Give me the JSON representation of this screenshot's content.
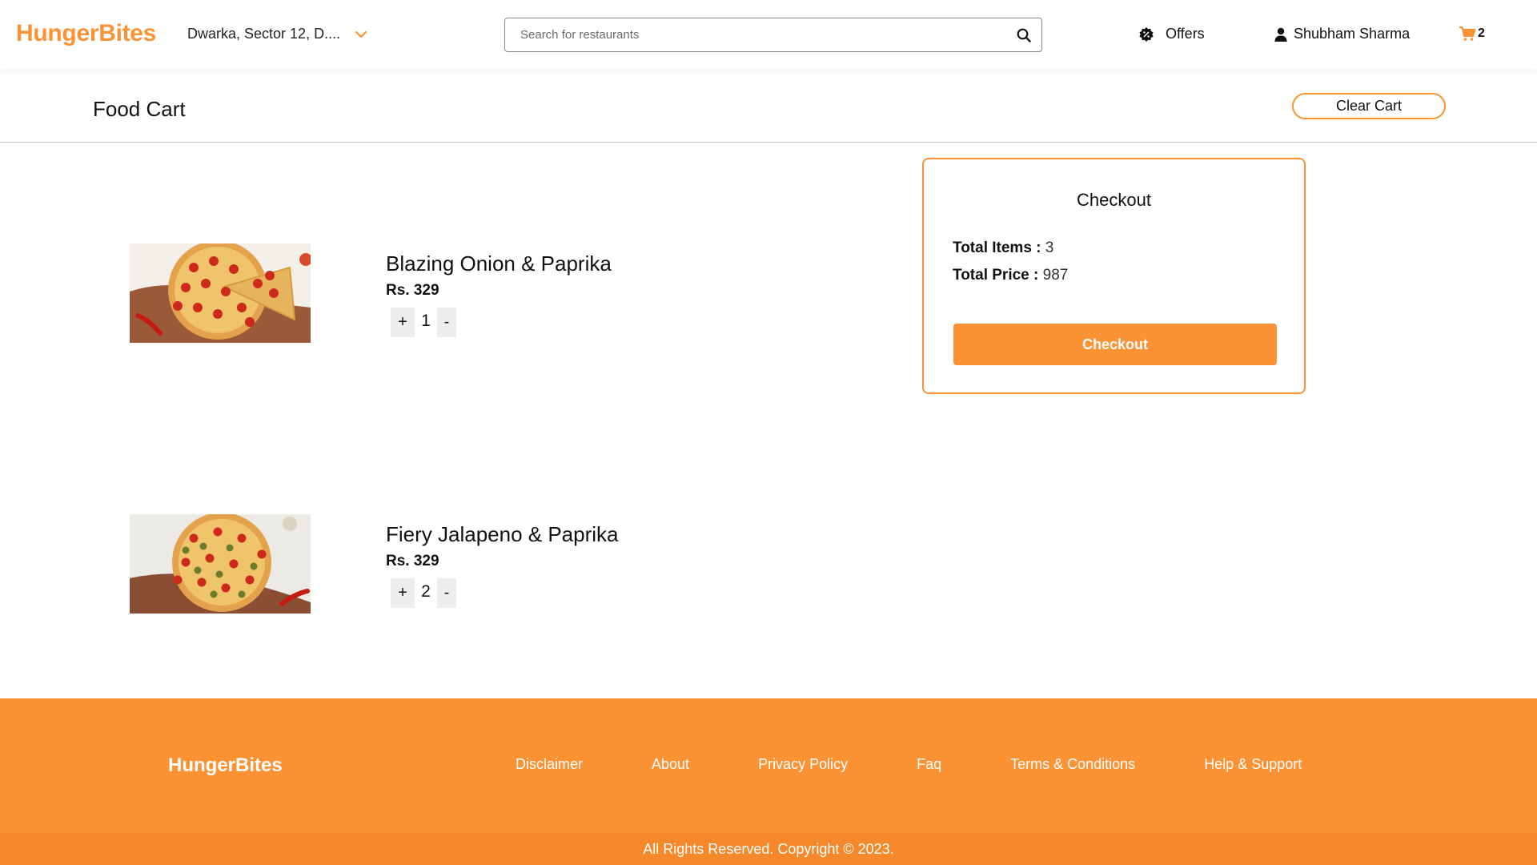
{
  "header": {
    "logo": "HungerBites",
    "location": "Dwarka, Sector 12, D....",
    "search_placeholder": "Search for restaurants",
    "offers_label": "Offers",
    "user_name": "Shubham Sharma",
    "cart_count": "2"
  },
  "cart": {
    "title": "Food Cart",
    "clear_label": "Clear Cart",
    "items": [
      {
        "name": "Blazing Onion & Paprika",
        "price": "Rs. 329",
        "quantity": "1",
        "plus": "+",
        "minus": "-"
      },
      {
        "name": "Fiery Jalapeno & Paprika",
        "price": "Rs. 329",
        "quantity": "2",
        "plus": "+",
        "minus": "-"
      }
    ]
  },
  "checkout": {
    "title": "Checkout",
    "total_items_label": "Total Items :",
    "total_items_value": "3",
    "total_price_label": "Total Price :",
    "total_price_value": "987",
    "button_label": "Checkout"
  },
  "footer": {
    "logo": "HungerBites",
    "links": [
      "Disclaimer",
      "About",
      "Privacy Policy",
      "Faq",
      "Terms & Conditions",
      "Help & Support"
    ],
    "copyright": "All Rights Reserved. Copyright © 2023."
  },
  "colors": {
    "accent": "#fb9233"
  },
  "icons": {
    "location_chevron": "chevron-down-icon",
    "search": "search-icon",
    "offers": "discount-badge-icon",
    "user": "user-icon",
    "cart": "shopping-cart-icon"
  }
}
